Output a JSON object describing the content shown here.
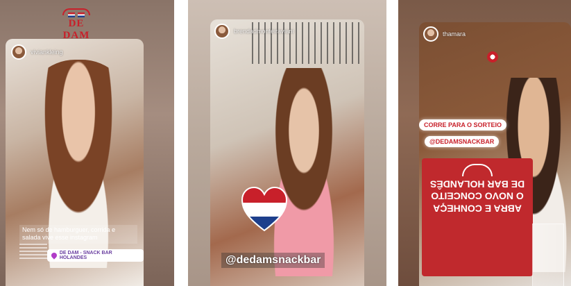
{
  "panels": [
    {
      "top_text": "",
      "logo_text": "DE DAM",
      "username": "viviankleing",
      "caption": "Nem só de hamburguer, corrida e salada vive esse instagram",
      "location_label": "DE DAM - SNACK BAR HOLANDES"
    },
    {
      "username": "brendadmonteiraviani",
      "mention": "@dedamsnackbar"
    },
    {
      "username": "thamara",
      "bubble1": "CORRE PARA O SORTEIO",
      "bubble2": "@DEDAMSNACKBAR",
      "sign_lines": [
        "ABRA E CONHEÇA",
        "O NOVO CONCEITO",
        "DE BAR HOLANDÊS"
      ]
    }
  ],
  "colors": {
    "brand_red": "#c8202a",
    "dutch_blue": "#1d3f8c",
    "location_purple": "#b03cc8"
  },
  "icons": [
    "avatar",
    "location-pin-icon",
    "dutch-flag-heart-icon",
    "brand-badge-icon"
  ]
}
